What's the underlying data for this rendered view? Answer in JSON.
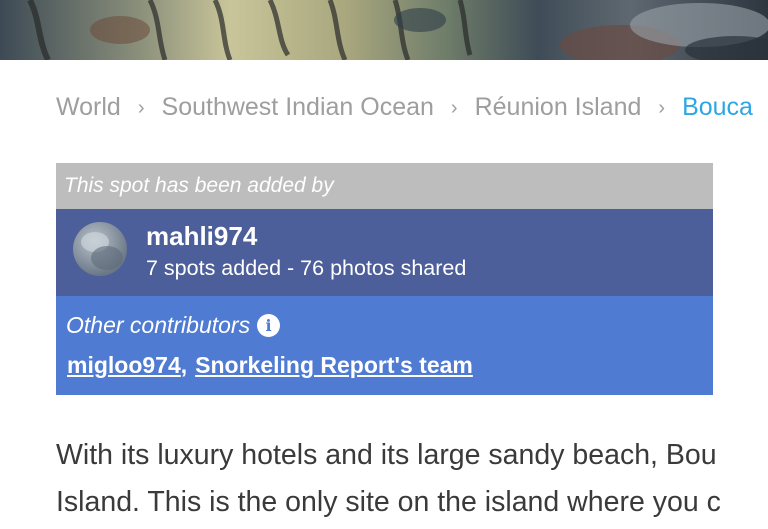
{
  "breadcrumb": {
    "items": [
      "World",
      "Southwest Indian Ocean",
      "Réunion Island",
      "Bouca"
    ],
    "separator": "›"
  },
  "contributors": {
    "added_by_label": "This spot has been added by",
    "author": {
      "name": "mahli974",
      "stats": "7 spots added - 76 photos shared"
    },
    "others_label": "Other contributors",
    "info_icon": "i",
    "others": [
      "migloo974",
      "Snorkeling Report's team"
    ],
    "others_separator": ","
  },
  "description": {
    "line1": "With its luxury hotels and its large sandy beach, Bou",
    "line2": "Island. This is the only site on the island where you c"
  },
  "colors": {
    "added_by_bg": "#bdbdbd",
    "author_bg": "#4c5f9a",
    "others_bg": "#4f7bd2",
    "breadcrumb_current": "#2ea6e4"
  }
}
